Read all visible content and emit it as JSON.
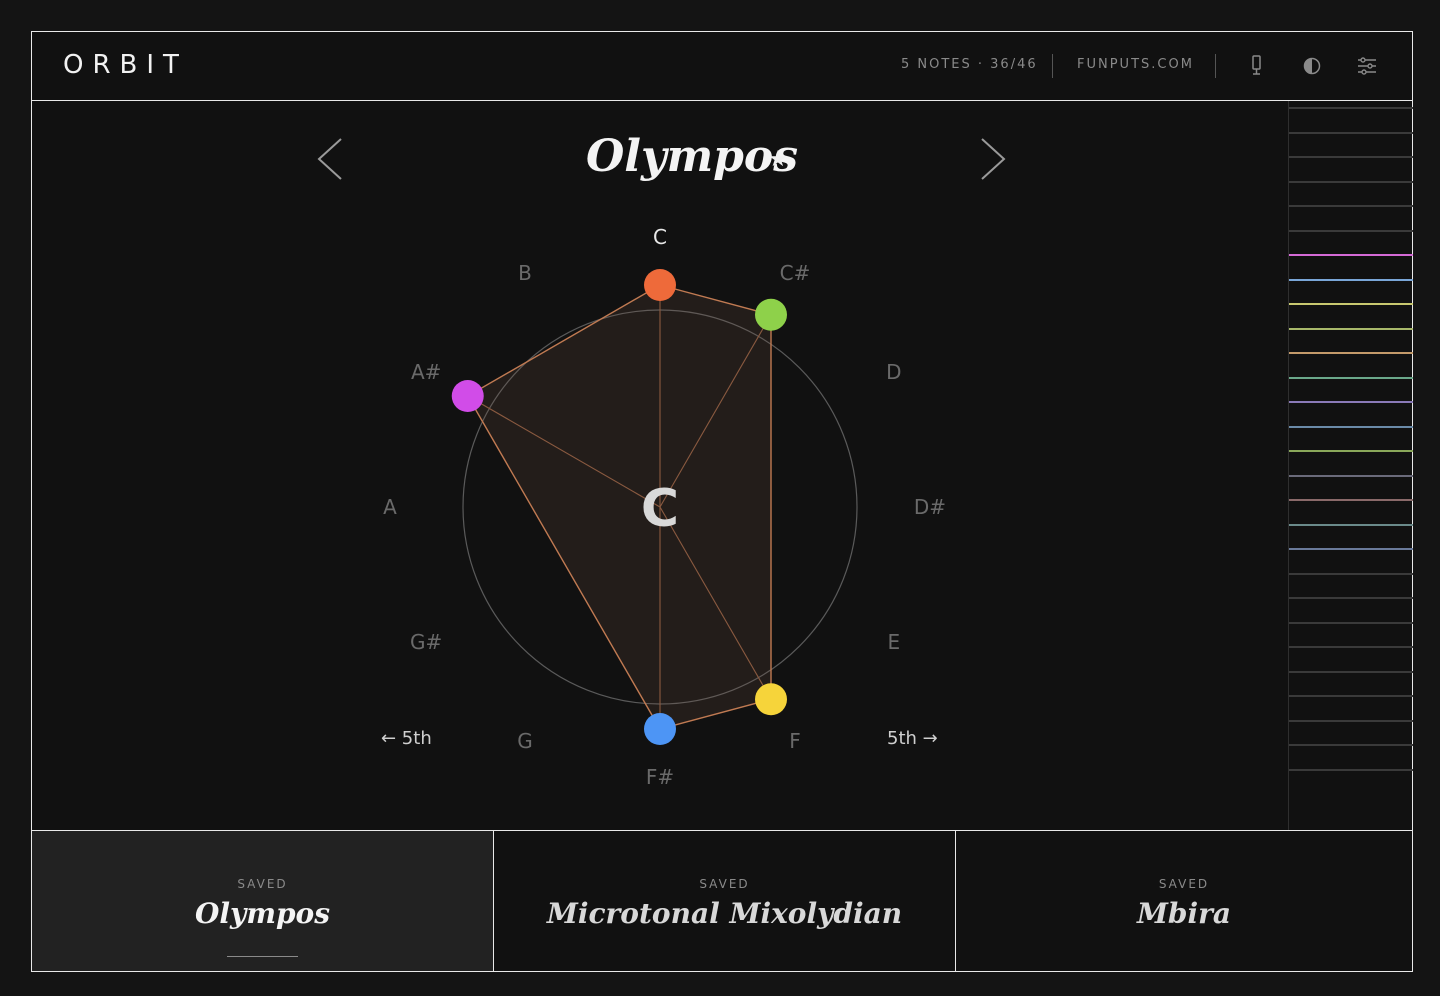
{
  "header": {
    "logo": "ORBIT",
    "notes_info": "5 NOTES · 36/46",
    "site": "FUNPUTS.COM",
    "icons": [
      "microphone-icon",
      "contrast-icon",
      "sliders-icon"
    ]
  },
  "scale": {
    "title": "Olympos",
    "starred": true,
    "root": "C",
    "note_labels": [
      "C",
      "C#",
      "D",
      "D#",
      "E",
      "F",
      "F#",
      "G",
      "G#",
      "A",
      "A#",
      "B"
    ],
    "fifth_left": "← 5th",
    "fifth_right": "5th →",
    "notes": [
      {
        "label": "C",
        "color": "#ee6a3a"
      },
      {
        "label": "C#",
        "color": "#8ed14a"
      },
      {
        "label": "F",
        "color": "#f6d43a"
      },
      {
        "label": "F#",
        "color": "#4d95f5"
      },
      {
        "label": "A#",
        "color": "#d14ce8"
      }
    ]
  },
  "key_lines": [
    {
      "color": "#3a3a3a"
    },
    {
      "color": "#3a3a3a"
    },
    {
      "color": "#3a3a3a"
    },
    {
      "color": "#3a3a3a"
    },
    {
      "color": "#3a3a3a"
    },
    {
      "color": "#3a3a3a"
    },
    {
      "color": "#d56ad6"
    },
    {
      "color": "#7aa6d8"
    },
    {
      "color": "#c8c870"
    },
    {
      "color": "#a8b86a"
    },
    {
      "color": "#c49a6a"
    },
    {
      "color": "#6aa88a"
    },
    {
      "color": "#8a7ab8"
    },
    {
      "color": "#6a8aa8"
    },
    {
      "color": "#8aa85a"
    },
    {
      "color": "#6a6a7a"
    },
    {
      "color": "#8a6a6a"
    },
    {
      "color": "#6a8a8a"
    },
    {
      "color": "#6a7a9a"
    },
    {
      "color": "#3a3a3a"
    },
    {
      "color": "#3a3a3a"
    },
    {
      "color": "#3a3a3a"
    },
    {
      "color": "#3a3a3a"
    },
    {
      "color": "#3a3a3a"
    },
    {
      "color": "#3a3a3a"
    },
    {
      "color": "#3a3a3a"
    },
    {
      "color": "#3a3a3a"
    },
    {
      "color": "#3a3a3a"
    }
  ],
  "saved": [
    {
      "label": "SAVED",
      "name": "Olympos",
      "active": true
    },
    {
      "label": "SAVED",
      "name": "Microtonal Mixolydian",
      "active": false
    },
    {
      "label": "SAVED",
      "name": "Mbira",
      "active": false
    }
  ]
}
